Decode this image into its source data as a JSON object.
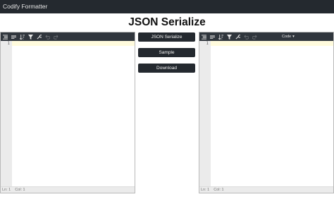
{
  "app": {
    "name": "Codify Formatter"
  },
  "page": {
    "title": "JSON Serialize"
  },
  "left_editor": {
    "toolbar_icons": [
      "format-icon",
      "compact-icon",
      "sort-icon",
      "filter-icon",
      "repair-icon",
      "undo-icon",
      "redo-icon"
    ],
    "line_number": "1",
    "status": {
      "line": "Ln: 1",
      "col": "Col: 1"
    }
  },
  "right_editor": {
    "toolbar_icons": [
      "format-icon",
      "compact-icon",
      "sort-icon",
      "filter-icon",
      "repair-icon",
      "undo-icon",
      "redo-icon"
    ],
    "mode_select": "Code",
    "line_number": "1",
    "status": {
      "line": "Ln: 1",
      "col": "Col: 1"
    }
  },
  "actions": {
    "serialize_label": "JSON Serialize",
    "sample_label": "Sample",
    "download_label": "Download"
  },
  "colors": {
    "topbar": "#24292f",
    "toolbar": "#30363d",
    "button": "#24292f",
    "active_line": "#fffbdd"
  }
}
